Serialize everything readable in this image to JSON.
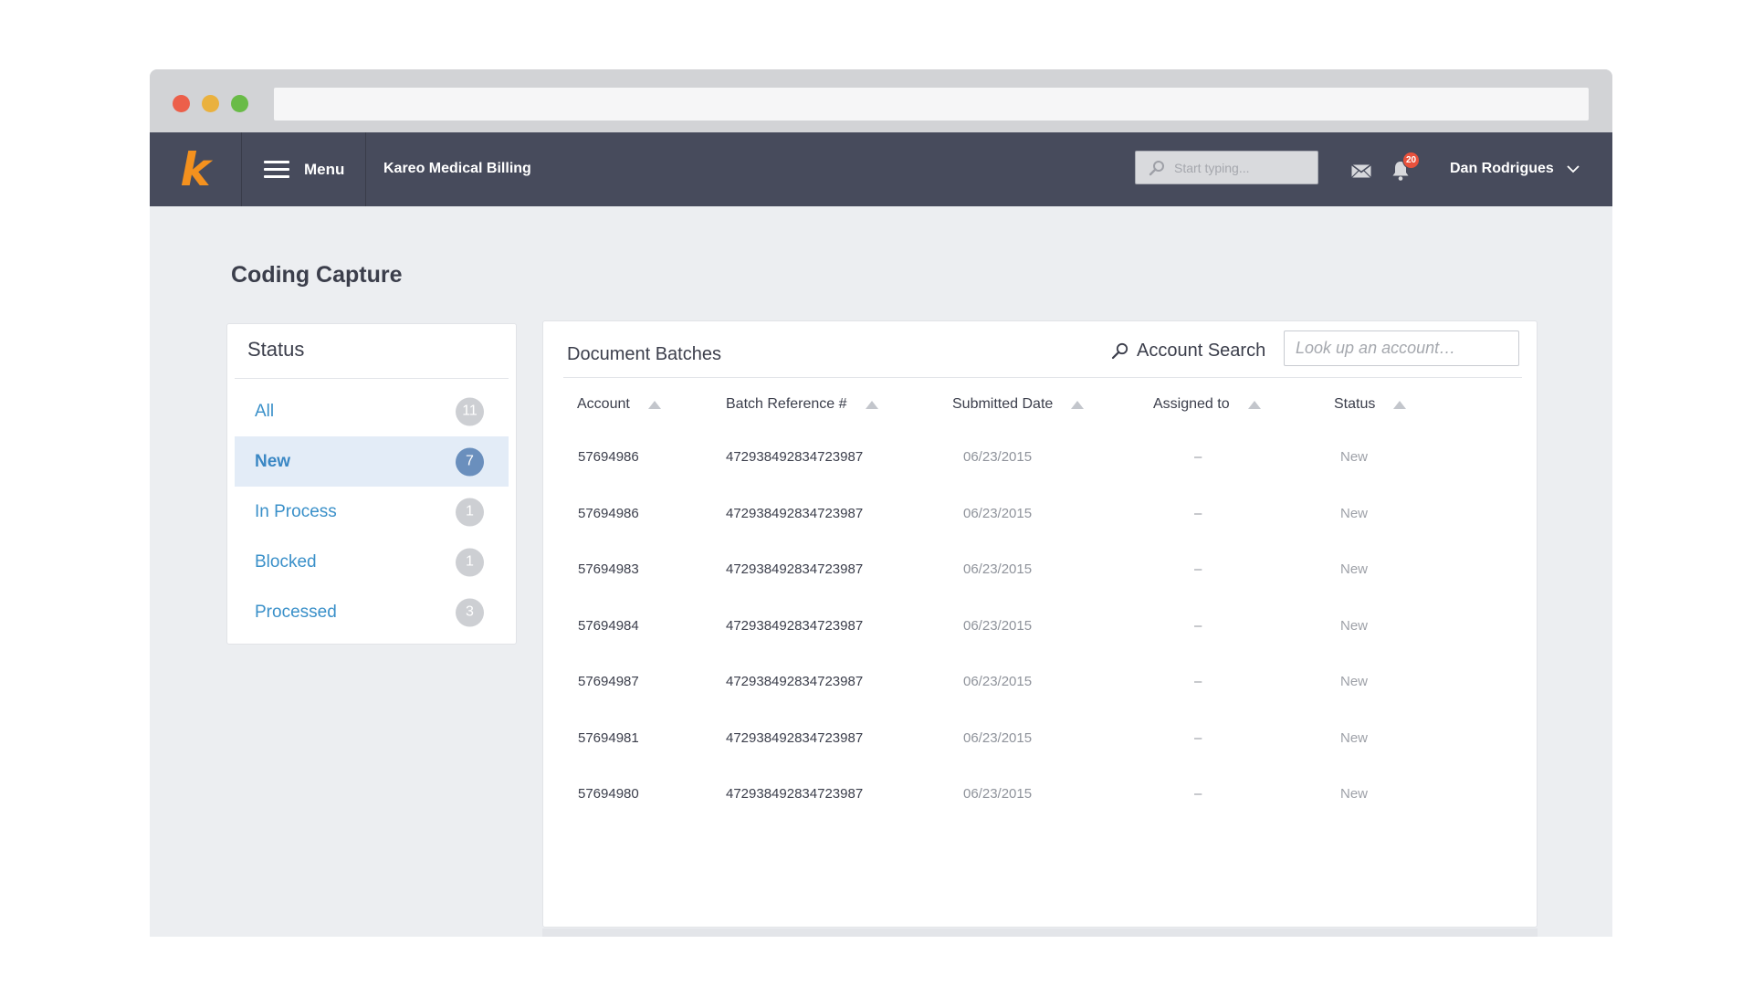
{
  "topnav": {
    "menu_label": "Menu",
    "app_title": "Kareo Medical Billing",
    "search_placeholder": "Start typing...",
    "notification_count": "20",
    "user_name": "Dan Rodrigues"
  },
  "page": {
    "title": "Coding Capture"
  },
  "status_panel": {
    "title": "Status",
    "items": [
      {
        "label": "All",
        "count": "11"
      },
      {
        "label": "New",
        "count": "7"
      },
      {
        "label": "In Process",
        "count": "1"
      },
      {
        "label": "Blocked",
        "count": "1"
      },
      {
        "label": "Processed",
        "count": "3"
      }
    ]
  },
  "batches": {
    "title": "Document Batches",
    "search_label": "Account Search",
    "search_placeholder": "Look up an account…",
    "columns": [
      "Account",
      "Batch Reference #",
      "Submitted Date",
      "Assigned to",
      "Status"
    ],
    "rows": [
      {
        "account": "57694986",
        "batch_ref": "472938492834723987",
        "date": "06/23/2015",
        "assigned": "–",
        "status": "New"
      },
      {
        "account": "57694986",
        "batch_ref": "472938492834723987",
        "date": "06/23/2015",
        "assigned": "–",
        "status": "New"
      },
      {
        "account": "57694983",
        "batch_ref": "472938492834723987",
        "date": "06/23/2015",
        "assigned": "–",
        "status": "New"
      },
      {
        "account": "57694984",
        "batch_ref": "472938492834723987",
        "date": "06/23/2015",
        "assigned": "–",
        "status": "New"
      },
      {
        "account": "57694987",
        "batch_ref": "472938492834723987",
        "date": "06/23/2015",
        "assigned": "–",
        "status": "New"
      },
      {
        "account": "57694981",
        "batch_ref": "472938492834723987",
        "date": "06/23/2015",
        "assigned": "–",
        "status": "New"
      },
      {
        "account": "57694980",
        "batch_ref": "472938492834723987",
        "date": "06/23/2015",
        "assigned": "–",
        "status": "New"
      }
    ]
  },
  "colors": {
    "nav_bg": "#474b5c",
    "brand_orange": "#f4911e",
    "link_blue": "#3a90c9",
    "active_bg": "#e3ecf7",
    "badge_red": "#e8513c"
  }
}
